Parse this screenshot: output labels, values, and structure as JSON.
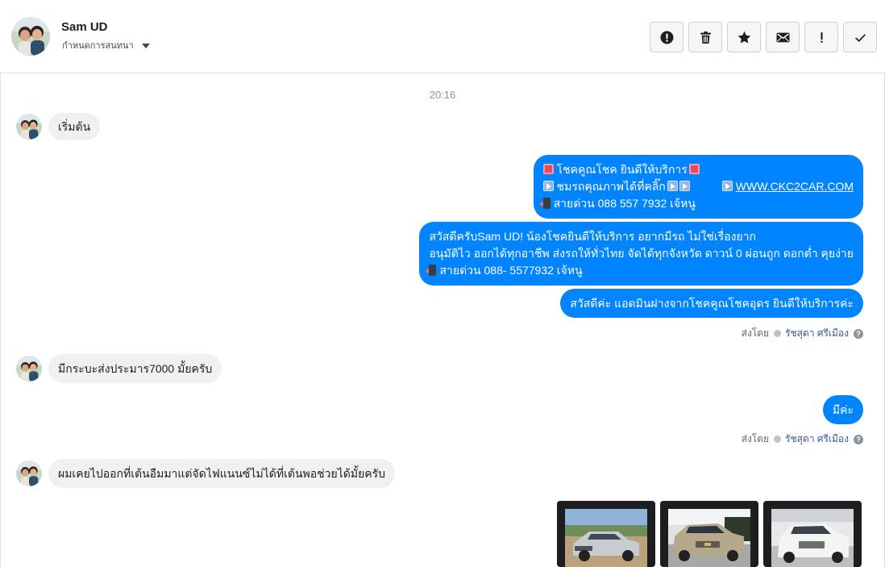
{
  "header": {
    "contact_name": "Sam UD",
    "assign_label": "กำหนดการสนทนา",
    "actions": [
      {
        "name": "spam-icon",
        "label": "spam"
      },
      {
        "name": "trash-icon",
        "label": "delete"
      },
      {
        "name": "star-icon",
        "label": "star"
      },
      {
        "name": "envelope-icon",
        "label": "mark unread"
      },
      {
        "name": "follow-up-icon",
        "label": "follow up"
      },
      {
        "name": "check-icon",
        "label": "done"
      }
    ]
  },
  "thread": {
    "timestamp": "20:16",
    "messages": [
      {
        "id": "m1",
        "direction": "in",
        "text": "เริ่มต้น"
      },
      {
        "id": "m2",
        "direction": "out",
        "lines": [
          "โชคคูณโชค ยินดีให้บริการ",
          "ชมรถคุณภาพได้ที่คลิ๊ก",
          "WWW.CKC2CAR.COM",
          "สายด่วน 088 557 7932 เจ้หนู"
        ]
      },
      {
        "id": "m3",
        "direction": "out",
        "lines": [
          "สวัสดีครับSam UD! น้องโชคยินดีให้บริการ อยากมีรถ ไม่ใช่เรื่องยาก",
          "อนุมัติไว ออกได้ทุกอาชีพ ส่งรถให้ทั่วไทย จัดได้ทุกจังหวัด ดาวน์ 0  ผ่อนถูก ดอกต่ำ คุยง่าย",
          "สายด่วน 088- 5577932 เจ้หนู"
        ]
      },
      {
        "id": "m4",
        "direction": "out",
        "text": "สวัสดีค่ะ แอดมินฝางจากโชคคูณโชคอุดร ยินดีให้บริการค่ะ"
      },
      {
        "id": "m5",
        "direction": "in",
        "text": "มีกระบะส่งประมาร7000 มั้ยครับ"
      },
      {
        "id": "m6",
        "direction": "out",
        "text": "มีค่ะ"
      },
      {
        "id": "m7",
        "direction": "in",
        "text": "ผมเคยไปออกที่เต้นอืมมาแต่จัดไฟแนนซ์ไม่ได้ที่เต้นพอช่วยได้มั้ยครับ"
      }
    ],
    "sent_by": {
      "prefix": "ส่งโดย",
      "agent": "รัชสุดา ศรีเมือง"
    },
    "photos": [
      {
        "name": "car-photo-silver-pickup"
      },
      {
        "name": "car-photo-chevrolet-pickup"
      },
      {
        "name": "car-photo-white-pickup"
      }
    ]
  },
  "colors": {
    "outgoing_bubble": "#0084ff",
    "incoming_bubble": "#f1f0f0",
    "agent_link": "#385898"
  }
}
